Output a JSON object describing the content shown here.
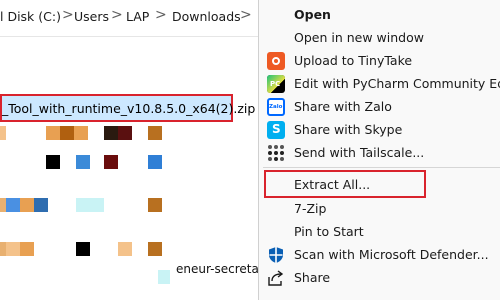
{
  "explorer": {
    "breadcrumb": [
      "l Disk (C:)",
      "Users",
      "LAP",
      "Downloads"
    ],
    "breadcrumb_separator": ">",
    "selected_file": "_Tool_with_runtime_v10.8.5.0_x64(2).zip",
    "thumbnail_caption": "eneur-secretary"
  },
  "context_menu": {
    "items": [
      {
        "label": "Open",
        "icon": "none",
        "bold": true
      },
      {
        "label": "Open in new window",
        "icon": "none"
      },
      {
        "label": "Upload to TinyTake",
        "icon": "tinytake-icon"
      },
      {
        "label": "Edit with PyCharm Community Editio",
        "icon": "pycharm-icon"
      },
      {
        "label": "Share with Zalo",
        "icon": "zalo-icon"
      },
      {
        "label": "Share with Skype",
        "icon": "skype-icon"
      },
      {
        "label": "Send with Tailscale...",
        "icon": "tailscale-icon"
      },
      {
        "label": "Extract All...",
        "icon": "none"
      },
      {
        "label": "7-Zip",
        "icon": "none"
      },
      {
        "label": "Pin to Start",
        "icon": "none"
      },
      {
        "label": "Scan with Microsoft Defender...",
        "icon": "defender-icon"
      },
      {
        "label": "Share",
        "icon": "share-icon"
      }
    ]
  },
  "colors": {
    "highlight_border": "#d9232d",
    "selection_fill": "#cce8ff",
    "menu_background": "#f9f9f9"
  }
}
